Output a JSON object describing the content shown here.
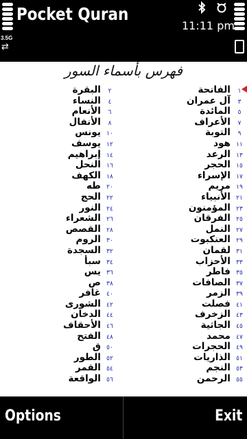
{
  "status": {
    "app_title": "Pocket Quran",
    "time": "11:11 pm",
    "network_mode": "3.5G",
    "transfer_icon": "⇄",
    "icons": [
      "signal-strength-icon",
      "bluetooth-icon",
      "alarm-icon",
      "battery-icon"
    ]
  },
  "index": {
    "title": "فهرس بأسماء السور",
    "marker_color": "#d8212a",
    "number_color": "#1a2aa8",
    "right_column": [
      {
        "num": "١",
        "name": "الفاتحة"
      },
      {
        "num": "٣",
        "name": "آل عمران"
      },
      {
        "num": "٥",
        "name": "المائدة"
      },
      {
        "num": "٧",
        "name": "الأعراف"
      },
      {
        "num": "٩",
        "name": "التوبة"
      },
      {
        "num": "١١",
        "name": "هود"
      },
      {
        "num": "١٣",
        "name": "الرعد"
      },
      {
        "num": "١٥",
        "name": "الحجر"
      },
      {
        "num": "١٧",
        "name": "الإسراء"
      },
      {
        "num": "١٩",
        "name": "مريم"
      },
      {
        "num": "٢١",
        "name": "الأنبياء"
      },
      {
        "num": "٢٣",
        "name": "المؤمنون"
      },
      {
        "num": "٢٥",
        "name": "الفرقان"
      },
      {
        "num": "٢٧",
        "name": "النمل"
      },
      {
        "num": "٢٩",
        "name": "العنكبوت"
      },
      {
        "num": "٣١",
        "name": "لقمان"
      },
      {
        "num": "٣٣",
        "name": "الأحزاب"
      },
      {
        "num": "٣٥",
        "name": "فاطر"
      },
      {
        "num": "٣٧",
        "name": "الصافات"
      },
      {
        "num": "٣٩",
        "name": "الزمر"
      },
      {
        "num": "٤١",
        "name": "فصلت"
      },
      {
        "num": "٤٣",
        "name": "الزخرف"
      },
      {
        "num": "٤٥",
        "name": "الجاثية"
      },
      {
        "num": "٤٧",
        "name": "محمد"
      },
      {
        "num": "٤٩",
        "name": "الحجرات"
      },
      {
        "num": "٥١",
        "name": "الذاريات"
      },
      {
        "num": "٥٣",
        "name": "النجم"
      },
      {
        "num": "٥٥",
        "name": "الرحمن"
      }
    ],
    "left_column": [
      {
        "num": "٢",
        "name": "البقرة"
      },
      {
        "num": "٤",
        "name": "النساء"
      },
      {
        "num": "٦",
        "name": "الأنعام"
      },
      {
        "num": "٨",
        "name": "الأنفال"
      },
      {
        "num": "١٠",
        "name": "يونس"
      },
      {
        "num": "١٢",
        "name": "يوسف"
      },
      {
        "num": "١٤",
        "name": "إبراهيم"
      },
      {
        "num": "١٦",
        "name": "النحل"
      },
      {
        "num": "١٨",
        "name": "الكهف"
      },
      {
        "num": "٢٠",
        "name": "طه"
      },
      {
        "num": "٢٢",
        "name": "الحج"
      },
      {
        "num": "٢٤",
        "name": "النور"
      },
      {
        "num": "٢٦",
        "name": "الشعراء"
      },
      {
        "num": "٢٨",
        "name": "القصص"
      },
      {
        "num": "٣٠",
        "name": "الروم"
      },
      {
        "num": "٣٢",
        "name": "السجدة"
      },
      {
        "num": "٣٤",
        "name": "سبأ"
      },
      {
        "num": "٣٦",
        "name": "يس"
      },
      {
        "num": "٣٨",
        "name": "ص"
      },
      {
        "num": "٤٠",
        "name": "غافر"
      },
      {
        "num": "٤٢",
        "name": "الشورى"
      },
      {
        "num": "٤٤",
        "name": "الدخان"
      },
      {
        "num": "٤٦",
        "name": "الأحقاف"
      },
      {
        "num": "٤٨",
        "name": "الفتح"
      },
      {
        "num": "٥٠",
        "name": "ق"
      },
      {
        "num": "٥٢",
        "name": "الطور"
      },
      {
        "num": "٥٤",
        "name": "القمر"
      },
      {
        "num": "٥٦",
        "name": "الواقعة"
      }
    ]
  },
  "softkeys": {
    "left_label": "Options",
    "right_label": "Exit"
  }
}
